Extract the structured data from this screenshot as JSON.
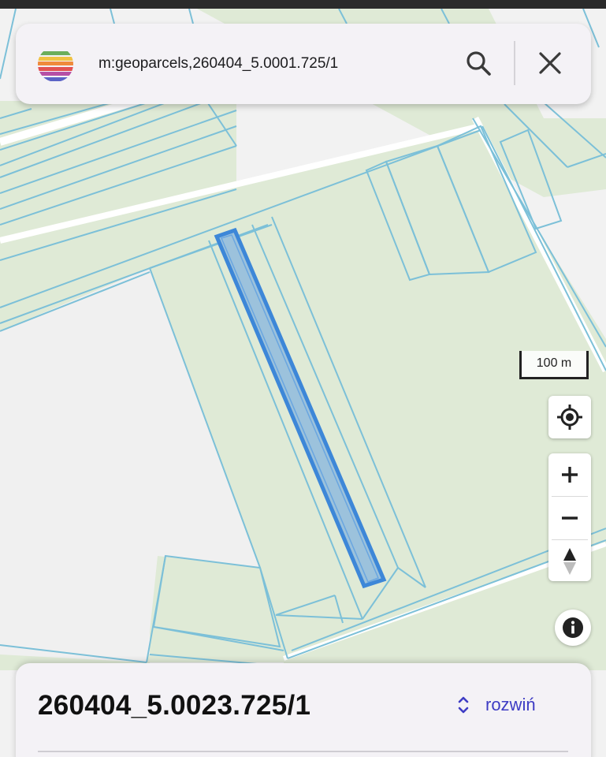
{
  "search": {
    "query": "m:geoparcels,260404_5.0001.725/1"
  },
  "logo": {
    "stripes": [
      "#6cae5a",
      "#f0c243",
      "#ef8a3c",
      "#e25252",
      "#b64fa6",
      "#5b63c6"
    ]
  },
  "map": {
    "scale_label": "100 m",
    "colors": {
      "background": "#f2f2f2",
      "green_area": "#dfead6",
      "parcel_outline": "#7cc0d8",
      "road": "#ffffff",
      "highlight_fill": "#9cc2dc",
      "highlight_stroke": "#3d87d8"
    }
  },
  "controls": {
    "locate_icon": "locate-icon",
    "zoom_in_icon": "plus-icon",
    "zoom_out_icon": "minus-icon",
    "compass_icon": "compass-icon",
    "info_icon": "info-icon"
  },
  "sheet": {
    "parcel_id": "260404_5.0023.725/1",
    "expand_label": "rozwiń",
    "expand_icon": "unfold-icon",
    "accent": "#3e3cc4"
  }
}
